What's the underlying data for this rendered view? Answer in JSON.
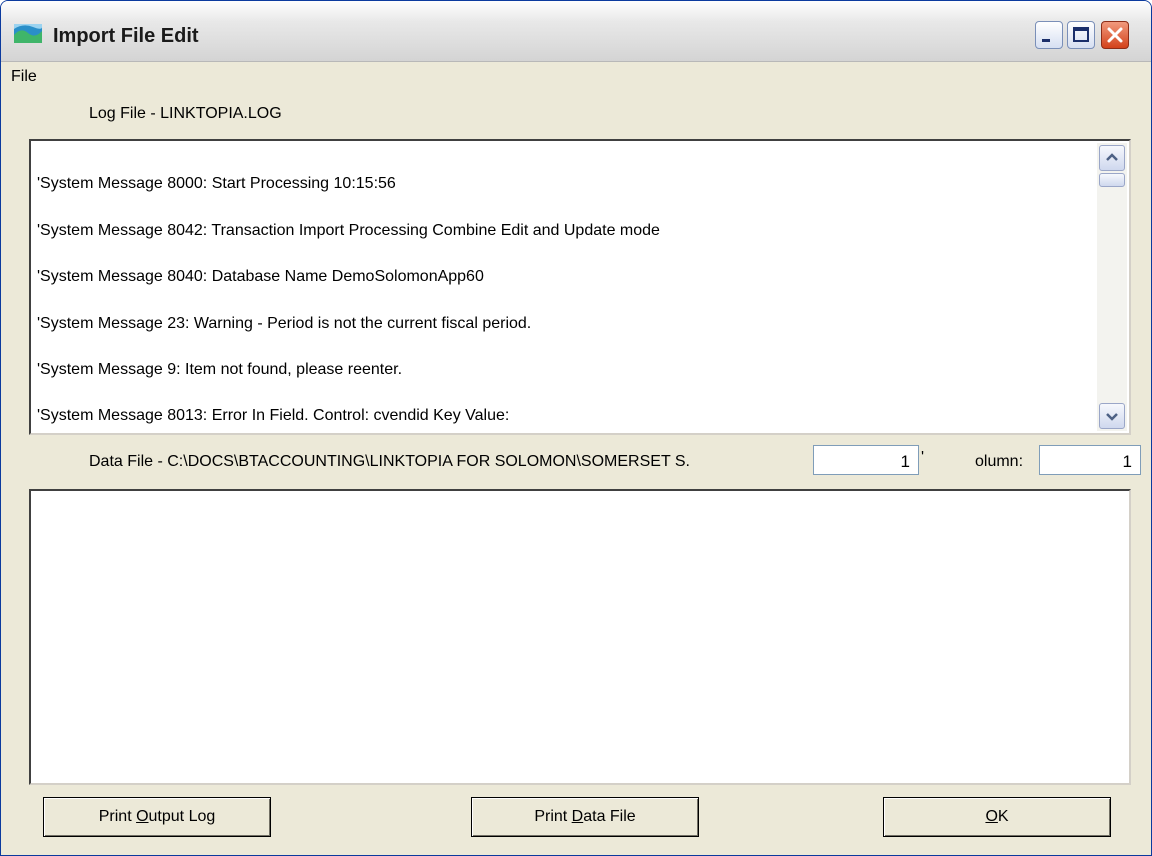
{
  "window": {
    "title": "Import File Edit"
  },
  "menu": {
    "file_label": "File"
  },
  "log": {
    "label": "Log File -  LINKTOPIA.LOG",
    "lines": [
      "'System Message 8000: Start Processing 10:15:56",
      "'System Message 8042: Transaction Import Processing Combine Edit and Update mode",
      "'System Message 8040: Database Name DemoSolomonApp60",
      "'System Message 23: Warning - Period is not the current fiscal period.",
      "'System Message 9: Item not found, please reenter.",
      "'System Message 8013: Error In Field. Control: cvendid Key Value:"
    ]
  },
  "data_file": {
    "label": "Data File -  C:\\DOCS\\BTACCOUNTING\\LINKTOPIA FOR SOLOMON\\SOMERSET S.",
    "row_value": "1",
    "row_label_fragment": "'",
    "column_label": "olumn:",
    "column_value": "1"
  },
  "buttons": {
    "print_output_log": {
      "pre": "Print ",
      "mnemonic": "O",
      "post": "utput Log"
    },
    "print_data_file": {
      "pre": "Print ",
      "mnemonic": "D",
      "post": "ata File"
    },
    "ok": {
      "pre": "",
      "mnemonic": "O",
      "post": "K"
    }
  }
}
